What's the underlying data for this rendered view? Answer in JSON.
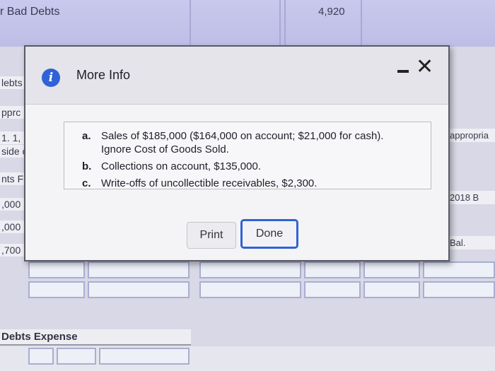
{
  "background": {
    "header_title": "r Bad Debts",
    "header_value": "4,920",
    "left_labels": [
      "lebts",
      "pprc",
      "1. 1,",
      "side c",
      "nts F",
      ",000",
      ",000",
      ",700"
    ],
    "right_labels": [
      "appropria",
      "2018 B",
      "Bal."
    ],
    "expense_label": "Debts Expense"
  },
  "modal": {
    "title": "More Info",
    "icon": "info-icon",
    "items": [
      {
        "letter": "a.",
        "text": "Sales of $185,000 ($164,000 on account; $21,000 for cash).",
        "text2": "Ignore Cost of Goods Sold."
      },
      {
        "letter": "b.",
        "text": "Collections on account, $135,000."
      },
      {
        "letter": "c.",
        "text": "Write-offs of uncollectible receivables, $2,300."
      }
    ],
    "print_label": "Print",
    "done_label": "Done"
  },
  "colors": {
    "accent": "#2f63d6",
    "header_band": "#c9c9ee"
  }
}
